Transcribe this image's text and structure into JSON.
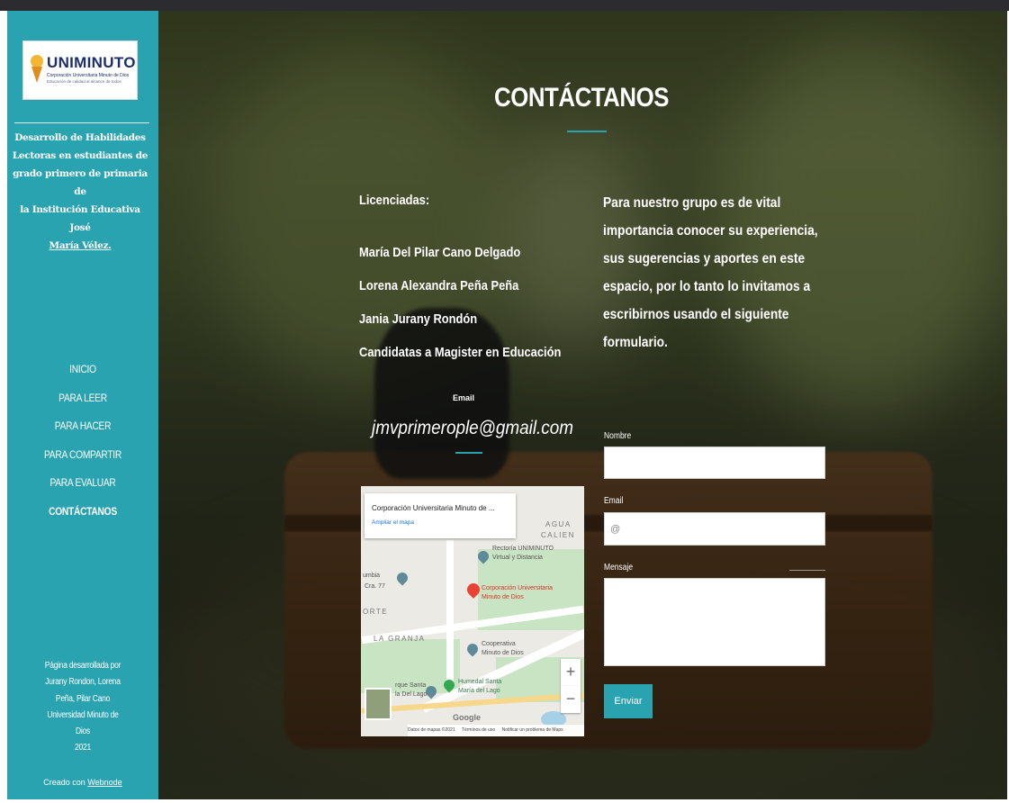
{
  "sidebar": {
    "logo": {
      "word": "UNIMINUTO",
      "sub1": "Corporación Universitaria Minuto de Dios",
      "sub2": "Educación de calidad al alcance de todos"
    },
    "description": {
      "line1": "Desarrollo de Habilidades",
      "line2": "Lectoras en estudiantes de",
      "line3": "grado primero de primaria de",
      "line4": "la Institución Educativa José",
      "line5": "María Vélez."
    },
    "nav": [
      "INICIO",
      "PARA LEER",
      "PARA HACER",
      "PARA COMPARTIR",
      "PARA EVALUAR",
      "CONTÁCTANOS"
    ],
    "active_nav": "CONTÁCTANOS",
    "footer": {
      "line1": "Página desarrollada por",
      "line2": "Jurany Rondon, Lorena",
      "line3": "Peña, Pilar Cano",
      "line4": "Universidad Minuto de",
      "line5": "Dios",
      "line6": "2021"
    },
    "created_prefix": "Creado con",
    "created_link": "Webnode"
  },
  "main": {
    "title": "CONTÁCTANOS",
    "licenciadas_heading": "Licenciadas:",
    "names": [
      "María Del Pilar Cano Delgado",
      "Lorena Alexandra Peña Peña",
      "Jania Jurany Rondón",
      "Candidatas a Magister en Educación"
    ],
    "email_label": "Email",
    "email_value": "jmvprimerople@gmail.com",
    "intro": {
      "line1": "Para nuestro grupo es de vital",
      "line2": "importancia conocer su experiencia,",
      "line3": "sus sugerencias y aportes en este",
      "line4": "espacio, por lo tanto lo invitamos a",
      "line5": "escribirnos usando el siguiente",
      "line6": "formulario."
    }
  },
  "form": {
    "name_label": "Nombre",
    "name_value": "",
    "email_label": "Email",
    "email_placeholder": "@",
    "message_label": "Mensaje",
    "message_value": "",
    "submit_label": "Enviar"
  },
  "map": {
    "card_title": "Corporación Universitaria Minuto de ...",
    "card_link": "Ampliar el mapa",
    "labels": {
      "rectoria_1": "Rectoría UNIMINUTO",
      "rectoria_2": "Virtual y Distancia",
      "corporacion_1": "Corporación Universitaria",
      "corporacion_2": "Minuto de Dios",
      "cooperativa_1": "Cooperativa",
      "cooperativa_2": "Minuto de Dios",
      "humedal_1": "Humedal Santa",
      "humedal_2": "María del Lago",
      "area_granja": "LA GRANJA",
      "area_norte": "ORTE",
      "area_agua": "AGUA",
      "area_calien": "CALIEN",
      "cra": "Cra. 77",
      "zona": "umbia",
      "parque_1": "rque Santa",
      "parque_2": "la Del Lago",
      "google": "Google"
    },
    "zoom_in": "+",
    "zoom_out": "−",
    "attribution": [
      "Datos de mapas ©2021",
      "Términos de uso",
      "Notificar un problema de Maps"
    ]
  }
}
